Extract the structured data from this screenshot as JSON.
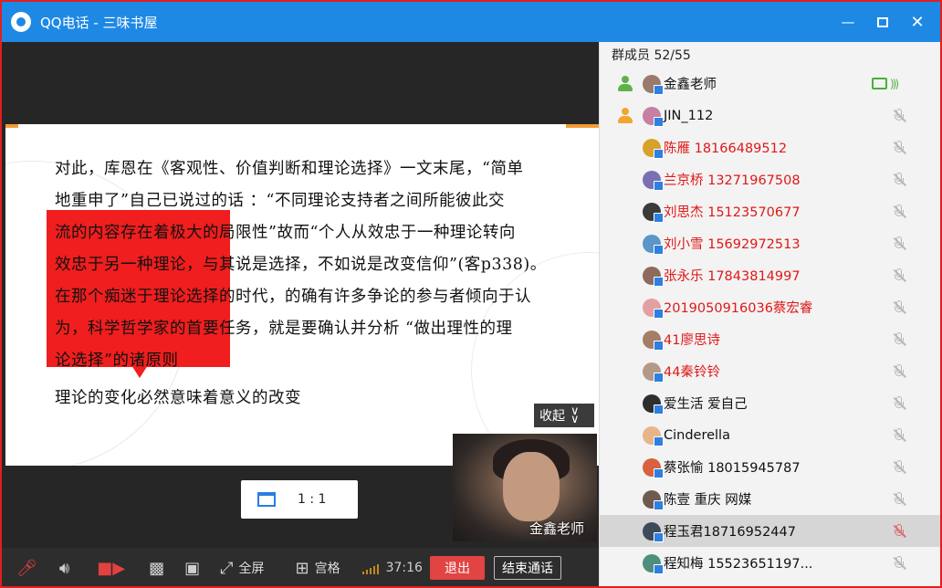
{
  "window": {
    "title": "QQ电话 - 三味书屋",
    "minimize_icon": "minimize-icon",
    "maximize_icon": "maximize-icon",
    "close_icon": "close-icon"
  },
  "slide": {
    "lines": [
      "对此，库恩在《客观性、价值判断和理论选择》一文末尾，“简单",
      "地重申了”自己已说过的话 ：“不同理论支持者之间所能彼此交",
      "流的内容存在着极大的局限性”故而“个人从效忠于一种理论转向",
      "效忠于另一种理论，与其说是选择，不如说是改变信仰”(客p338)。",
      "在那个痴迷于理论选择的时代，的确有许多争论的参与者倾向于认",
      "为，科学哲学家的首要任务，就是要确认并分析 “做出理性的理",
      "论选择”的诸原则"
    ],
    "last_line": "理论的变化必然意味着意义的改变",
    "highlight_color": "#f01e1e"
  },
  "collapse": {
    "label": "收起",
    "icon": "double-chevron-down-icon"
  },
  "view_ratio": {
    "label": "1 : 1",
    "icon": "window-icon"
  },
  "pip": {
    "name": "金鑫老师"
  },
  "toolbar": {
    "fullscreen_label": "全屏",
    "grid_label": "宫格",
    "elapsed": "37:16",
    "exit_label": "退出",
    "end_call_label": "结束通话",
    "accent_red": "#e24343"
  },
  "panel": {
    "title": "群成员 52/55",
    "members": [
      {
        "name": "金鑫老师",
        "role": "owner",
        "red": false,
        "status": "screen-sharing",
        "avatar": "#9a7a6a"
      },
      {
        "name": "JIN_112",
        "role": "admin",
        "red": false,
        "status": "mic-off",
        "avatar": "#c77fa4"
      },
      {
        "name": "陈雁 18166489512",
        "role": "",
        "red": true,
        "status": "mic-off",
        "avatar": "#d9a12a"
      },
      {
        "name": "兰京桥 13271967508",
        "role": "",
        "red": true,
        "status": "mic-off",
        "avatar": "#7b6fb2"
      },
      {
        "name": "刘思杰 15123570677",
        "role": "",
        "red": true,
        "status": "mic-off",
        "avatar": "#3b3b3b"
      },
      {
        "name": "刘小雪 15692972513",
        "role": "",
        "red": true,
        "status": "mic-off",
        "avatar": "#5b95c9"
      },
      {
        "name": "张永乐 17843814997",
        "role": "",
        "red": true,
        "status": "mic-off",
        "avatar": "#8d6b5a"
      },
      {
        "name": "2019050916036蔡宏睿",
        "role": "",
        "red": true,
        "status": "mic-off",
        "avatar": "#e3a0a0"
      },
      {
        "name": "41廖思诗",
        "role": "",
        "red": true,
        "status": "mic-off",
        "avatar": "#a47e66"
      },
      {
        "name": "44秦铃铃",
        "role": "",
        "red": true,
        "status": "mic-off",
        "avatar": "#b49a86"
      },
      {
        "name": "爱生活 爱自己",
        "role": "",
        "red": false,
        "status": "mic-off",
        "avatar": "#2e2e2e"
      },
      {
        "name": "Cinderella",
        "role": "",
        "red": false,
        "status": "mic-off",
        "avatar": "#e8b48a"
      },
      {
        "name": "蔡张愉 18015945787",
        "role": "",
        "red": false,
        "status": "mic-off",
        "avatar": "#d8623e"
      },
      {
        "name": "陈壹 重庆 网媒",
        "role": "",
        "red": false,
        "status": "mic-off",
        "avatar": "#6f5a4f"
      },
      {
        "name": "程玉君18716952447",
        "role": "",
        "red": false,
        "status": "mic-off-red",
        "avatar": "#3d4a5a",
        "selected": true
      },
      {
        "name": "程知梅    15523651197...",
        "role": "",
        "red": false,
        "status": "mic-off",
        "avatar": "#4f8e7c"
      }
    ]
  }
}
